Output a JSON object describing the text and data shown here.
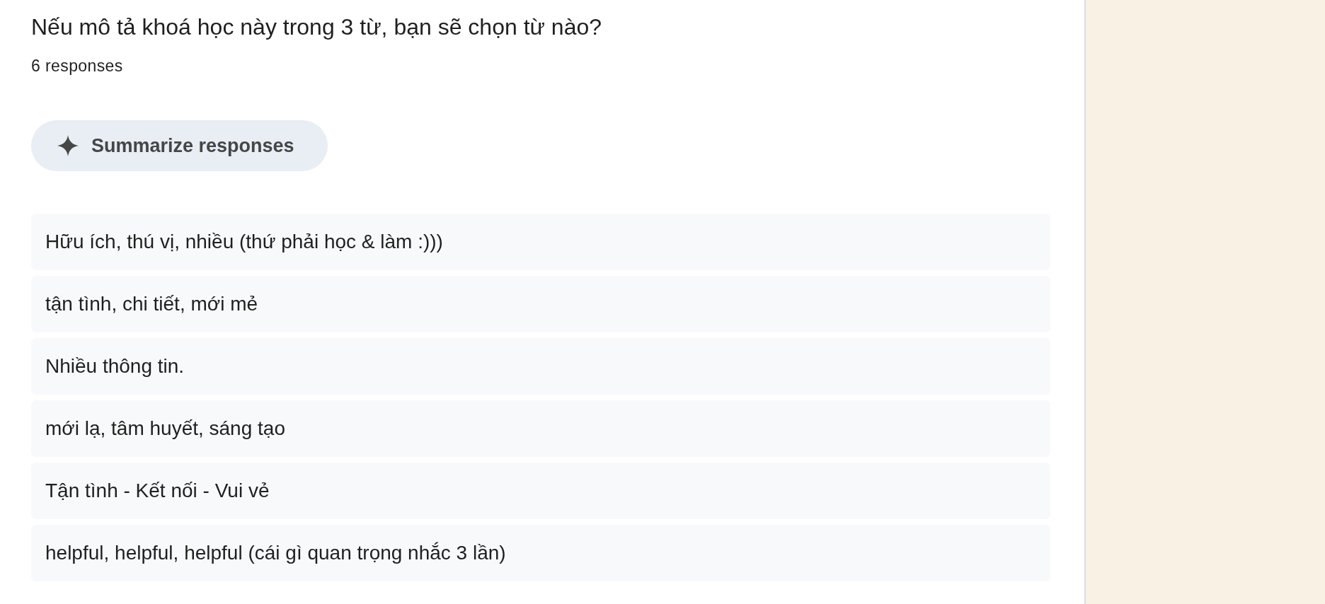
{
  "question": {
    "title": "Nếu mô tả khoá học này trong 3 từ, bạn sẽ chọn từ nào?",
    "response_count": "6 responses"
  },
  "summarize_button": {
    "label": "Summarize responses"
  },
  "responses": [
    "Hữu ích, thú vị, nhiều (thứ phải học & làm :)))",
    "tận tình, chi tiết, mới mẻ",
    "Nhiều thông tin.",
    "mới lạ, tâm huyết, sáng tạo",
    "Tận tình - Kết nối - Vui vẻ",
    "helpful, helpful, helpful (cái gì quan trọng nhắc 3 lần)"
  ]
}
